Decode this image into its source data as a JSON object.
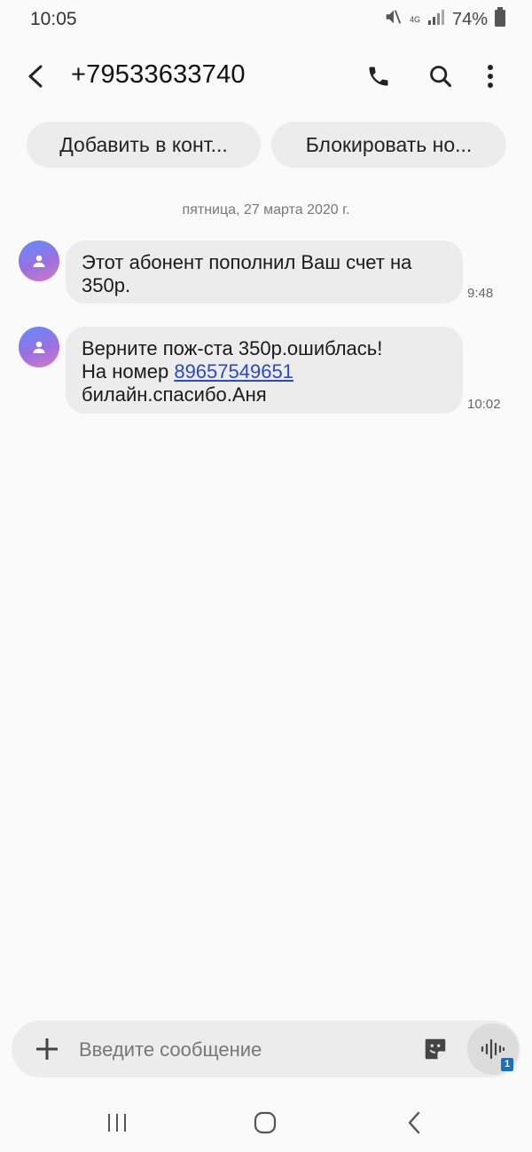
{
  "status": {
    "time": "10:05",
    "network": "4G",
    "battery_pct": "74%"
  },
  "header": {
    "title": "+79533633740"
  },
  "chips": {
    "add_contact": "Добавить в конт...",
    "block_number": "Блокировать но..."
  },
  "conversation": {
    "date": "пятница, 27 марта 2020 г.",
    "messages": [
      {
        "line1": "Этот абонент пополнил Ваш счет на",
        "line2": "350р.",
        "time": "9:48"
      },
      {
        "line1": "Верните пож-ста 350р.ошиблась!",
        "line2_prefix": "На номер ",
        "link": "89657549651",
        "line3": "билайн.спасибо.Аня",
        "time": "10:02"
      }
    ]
  },
  "composer": {
    "placeholder": "Введите сообщение",
    "sim_badge": "1"
  },
  "colors": {
    "background": "#fafafa",
    "bubble": "#ececec",
    "link": "#2b48c9",
    "sim_badge": "#1f6fb5"
  }
}
